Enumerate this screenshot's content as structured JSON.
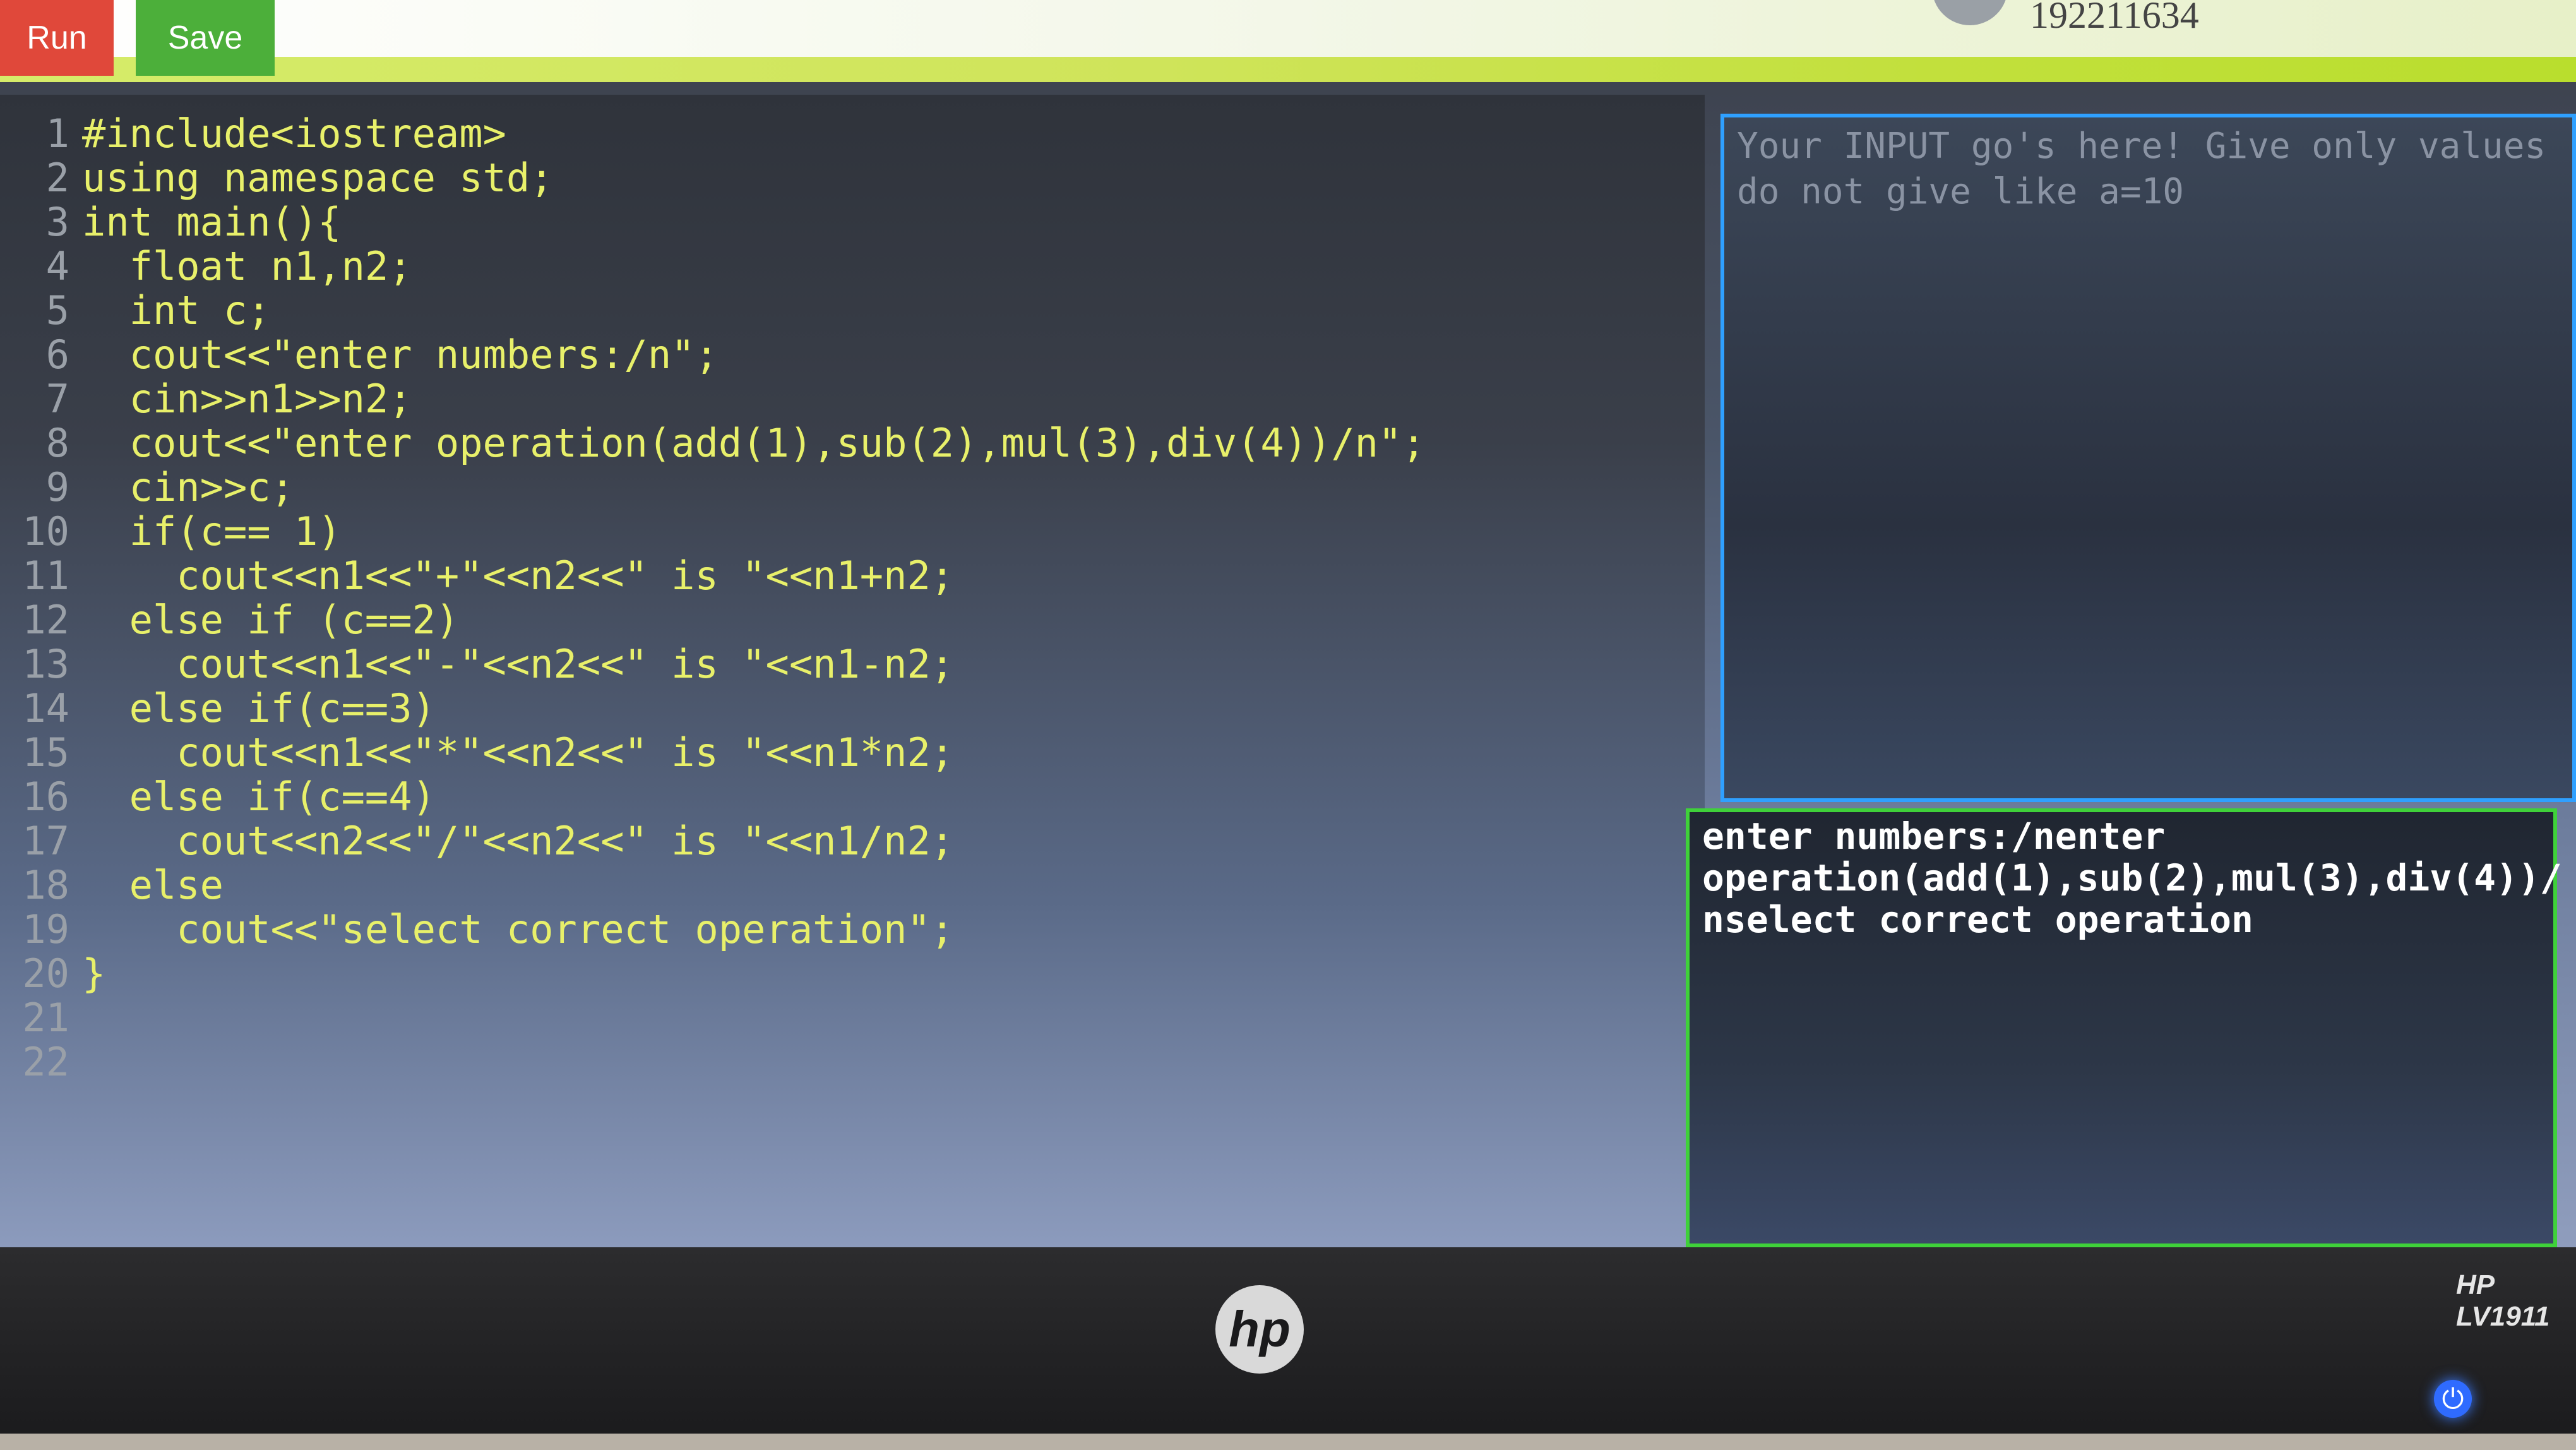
{
  "toolbar": {
    "run_label": "Run",
    "save_label": "Save"
  },
  "user": {
    "id": "192211634"
  },
  "editor": {
    "lines": [
      {
        "n": "1",
        "code": "#include<iostream>"
      },
      {
        "n": "2",
        "code": "using namespace std;"
      },
      {
        "n": "3",
        "code": "int main(){"
      },
      {
        "n": "4",
        "code": "  float n1,n2;"
      },
      {
        "n": "5",
        "code": "  int c;"
      },
      {
        "n": "6",
        "code": "  cout<<\"enter numbers:/n\";"
      },
      {
        "n": "7",
        "code": "  cin>>n1>>n2;"
      },
      {
        "n": "8",
        "code": "  cout<<\"enter operation(add(1),sub(2),mul(3),div(4))/n\";"
      },
      {
        "n": "9",
        "code": "  cin>>c;"
      },
      {
        "n": "10",
        "code": "  if(c== 1)"
      },
      {
        "n": "11",
        "code": "    cout<<n1<<\"+\"<<n2<<\" is \"<<n1+n2;"
      },
      {
        "n": "12",
        "code": "  else if (c==2)"
      },
      {
        "n": "13",
        "code": "    cout<<n1<<\"-\"<<n2<<\" is \"<<n1-n2;"
      },
      {
        "n": "14",
        "code": "  else if(c==3)"
      },
      {
        "n": "15",
        "code": "    cout<<n1<<\"*\"<<n2<<\" is \"<<n1*n2;"
      },
      {
        "n": "16",
        "code": "  else if(c==4)"
      },
      {
        "n": "17",
        "code": "    cout<<n2<<\"/\"<<n2<<\" is \"<<n1/n2;"
      },
      {
        "n": "18",
        "code": "  else"
      },
      {
        "n": "19",
        "code": "    cout<<\"select correct operation\";"
      },
      {
        "n": "20",
        "code": "}"
      },
      {
        "n": "21",
        "code": ""
      },
      {
        "n": "22",
        "code": ""
      }
    ]
  },
  "input_pane": {
    "placeholder": "Your INPUT go's here! Give only values\ndo not give like a=10"
  },
  "output_pane": {
    "text": "enter numbers:/nenter\noperation(add(1),sub(2),mul(3),div(4))/\nnselect correct operation"
  },
  "monitor": {
    "brand": "hp",
    "model": "HP LV1911",
    "power_icon": "power-icon"
  }
}
